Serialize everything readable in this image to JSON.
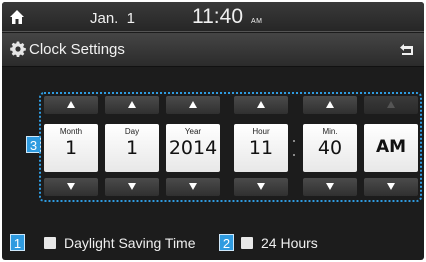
{
  "statusbar": {
    "date": "Jan.  1",
    "time": "11:40",
    "ampm": "AM"
  },
  "titlebar": {
    "title": "Clock Settings"
  },
  "picker": {
    "badge": "3",
    "columns": [
      {
        "label": "Month",
        "value": "1"
      },
      {
        "label": "Day",
        "value": "1"
      },
      {
        "label": "Year",
        "value": "2014"
      },
      {
        "label": "Hour",
        "value": "11"
      },
      {
        "label": "Min.",
        "value": "40"
      },
      {
        "label": "",
        "value": "AM"
      }
    ]
  },
  "options": {
    "dst_badge": "1",
    "dst_label": "Daylight Saving Time",
    "dst_checked": false,
    "h24_badge": "2",
    "h24_label": "24 Hours",
    "h24_checked": false
  },
  "colors": {
    "accent": "#2f9be0",
    "background": "#1c1c1c"
  },
  "icons": {
    "home": "home-icon",
    "settings": "gear-icon",
    "back": "back-arrow-icon",
    "up": "triangle-up-icon",
    "down": "triangle-down-icon"
  }
}
